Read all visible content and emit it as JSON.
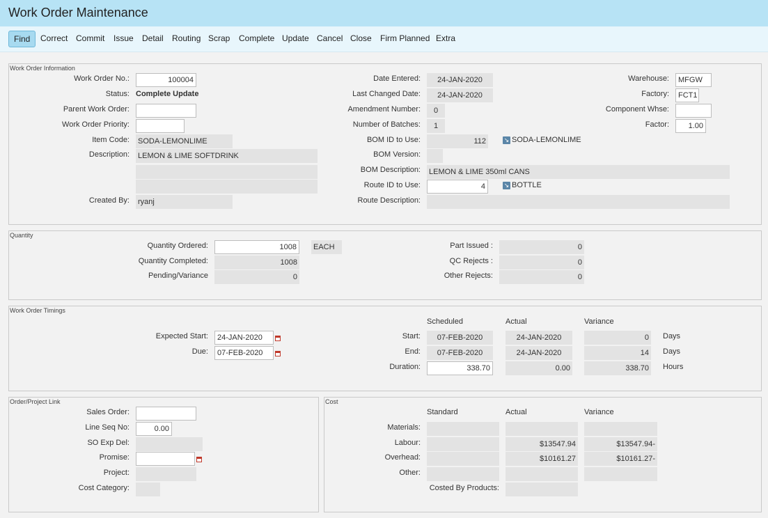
{
  "window": {
    "title": "Work Order Maintenance"
  },
  "toolbar": {
    "buttons": [
      "Find",
      "Correct",
      "Commit",
      "Issue",
      "Detail",
      "Routing",
      "Scrap",
      "Complete",
      "Update",
      "Cancel",
      "Close",
      "Firm Planned",
      "Extra"
    ]
  },
  "work_order_info": {
    "legend": "Work Order Information",
    "work_order_no": {
      "label": "Work Order No.:",
      "value": "100004"
    },
    "status": {
      "label": "Status:",
      "value": "Complete Update"
    },
    "parent_work_order": {
      "label": "Parent Work Order:",
      "value": ""
    },
    "work_order_priority": {
      "label": "Work Order Priority:",
      "value": ""
    },
    "item_code": {
      "label": "Item Code:",
      "value": "SODA-LEMONLIME"
    },
    "description": {
      "label": "Description:",
      "value": "LEMON & LIME SOFTDRINK",
      "line2": "",
      "line3": ""
    },
    "created_by": {
      "label": "Created By:",
      "value": "ryanj"
    },
    "date_entered": {
      "label": "Date Entered:",
      "value": "24-JAN-2020"
    },
    "last_changed_date": {
      "label": "Last Changed Date:",
      "value": "24-JAN-2020"
    },
    "amendment_number": {
      "label": "Amendment Number:",
      "value": "0"
    },
    "number_of_batches": {
      "label": "Number of Batches:",
      "value": "1"
    },
    "bom_id": {
      "label": "BOM ID to Use:",
      "value": "112",
      "link": "SODA-LEMONLIME"
    },
    "bom_version": {
      "label": "BOM Version:",
      "value": ""
    },
    "bom_description": {
      "label": "BOM Description:",
      "value": "LEMON & LIME 350ml CANS"
    },
    "route_id": {
      "label": "Route ID to Use:",
      "value": "4",
      "link": "BOTTLE"
    },
    "route_description": {
      "label": "Route Description:",
      "value": ""
    },
    "warehouse": {
      "label": "Warehouse:",
      "value": "MFGW"
    },
    "factory": {
      "label": "Factory:",
      "value": "FCT1"
    },
    "component_whse": {
      "label": "Component Whse:",
      "value": ""
    },
    "factor": {
      "label": "Factor:",
      "value": "1.00"
    }
  },
  "quantity": {
    "legend": "Quantity",
    "ordered": {
      "label": "Quantity Ordered:",
      "value": "1008",
      "uom": "EACH"
    },
    "completed": {
      "label": "Quantity Completed:",
      "value": "1008"
    },
    "pending_variance": {
      "label": "Pending/Variance",
      "value": "0"
    },
    "part_issued": {
      "label": "Part Issued :",
      "value": "0"
    },
    "qc_rejects": {
      "label": "QC Rejects :",
      "value": "0"
    },
    "other_rejects": {
      "label": "Other Rejects:",
      "value": "0"
    }
  },
  "timings": {
    "legend": "Work Order Timings",
    "expected_start": {
      "label": "Expected Start:",
      "value": "24-JAN-2020"
    },
    "due": {
      "label": "Due:",
      "value": "07-FEB-2020"
    },
    "headers": {
      "scheduled": "Scheduled",
      "actual": "Actual",
      "variance": "Variance"
    },
    "start": {
      "label": "Start:",
      "scheduled": "07-FEB-2020",
      "actual": "24-JAN-2020",
      "variance": "0",
      "unit": "Days"
    },
    "end": {
      "label": "End:",
      "scheduled": "07-FEB-2020",
      "actual": "24-JAN-2020",
      "variance": "14",
      "unit": "Days"
    },
    "duration": {
      "label": "Duration:",
      "scheduled": "338.70",
      "actual": "0.00",
      "variance": "338.70",
      "unit": "Hours"
    }
  },
  "order_project": {
    "legend": "Order/Project Link",
    "sales_order": {
      "label": "Sales Order:",
      "value": ""
    },
    "line_seq_no": {
      "label": "Line Seq No:",
      "value": "0.00"
    },
    "so_exp_del": {
      "label": "SO Exp Del:",
      "value": ""
    },
    "promise": {
      "label": "Promise:",
      "value": ""
    },
    "project": {
      "label": "Project:",
      "value": ""
    },
    "cost_category": {
      "label": "Cost Category:",
      "value": ""
    }
  },
  "cost": {
    "legend": "Cost",
    "headers": {
      "standard": "Standard",
      "actual": "Actual",
      "variance": "Variance"
    },
    "materials": {
      "label": "Materials:",
      "standard": "",
      "actual": "",
      "variance": ""
    },
    "labour": {
      "label": "Labour:",
      "standard": "",
      "actual": "$13547.94",
      "variance": "$13547.94-"
    },
    "overhead": {
      "label": "Overhead:",
      "standard": "",
      "actual": "$10161.27",
      "variance": "$10161.27-"
    },
    "other": {
      "label": "Other:",
      "standard": "",
      "actual": "",
      "variance": ""
    },
    "costed_by_products": {
      "label": "Costed By Products:",
      "value": ""
    }
  }
}
